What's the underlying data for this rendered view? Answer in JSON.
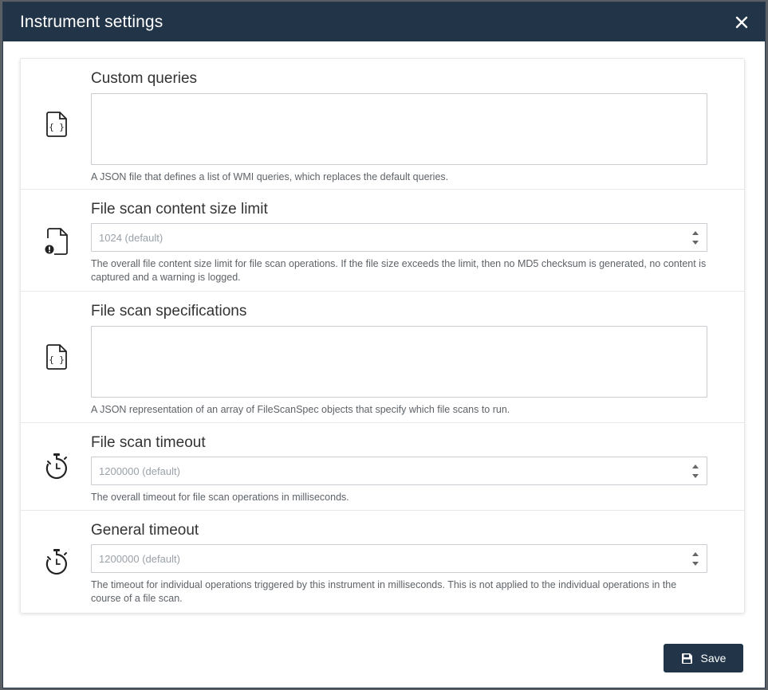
{
  "dialog": {
    "title": "Instrument settings",
    "close_icon": "close-icon"
  },
  "settings": [
    {
      "icon": "json-file-icon",
      "label": "Custom queries",
      "type": "textarea",
      "help": "A JSON file that defines a list of WMI queries, which replaces the default queries."
    },
    {
      "icon": "file-warning-icon",
      "label": "File scan content size limit",
      "type": "number",
      "placeholder": "1024 (default)",
      "help": "The overall file content size limit for file scan operations. If the file size exceeds the limit, then no MD5 checksum is generated, no content is captured and a warning is logged."
    },
    {
      "icon": "json-file-icon",
      "label": "File scan specifications",
      "type": "textarea",
      "help": "A JSON representation of an array of FileScanSpec objects that specify which file scans to run."
    },
    {
      "icon": "stopwatch-icon",
      "label": "File scan timeout",
      "type": "number",
      "placeholder": "1200000 (default)",
      "help": "The overall timeout for file scan operations in milliseconds."
    },
    {
      "icon": "stopwatch-icon",
      "label": "General timeout",
      "type": "number",
      "placeholder": "1200000 (default)",
      "help": "The timeout for individual operations triggered by this instrument in milliseconds. This is not applied to the individual operations in the course of a file scan."
    }
  ],
  "footer": {
    "save_label": "Save",
    "save_icon": "save-icon"
  },
  "colors": {
    "header_bg": "#223447",
    "button_bg": "#223447",
    "border": "#c9ccd0"
  }
}
